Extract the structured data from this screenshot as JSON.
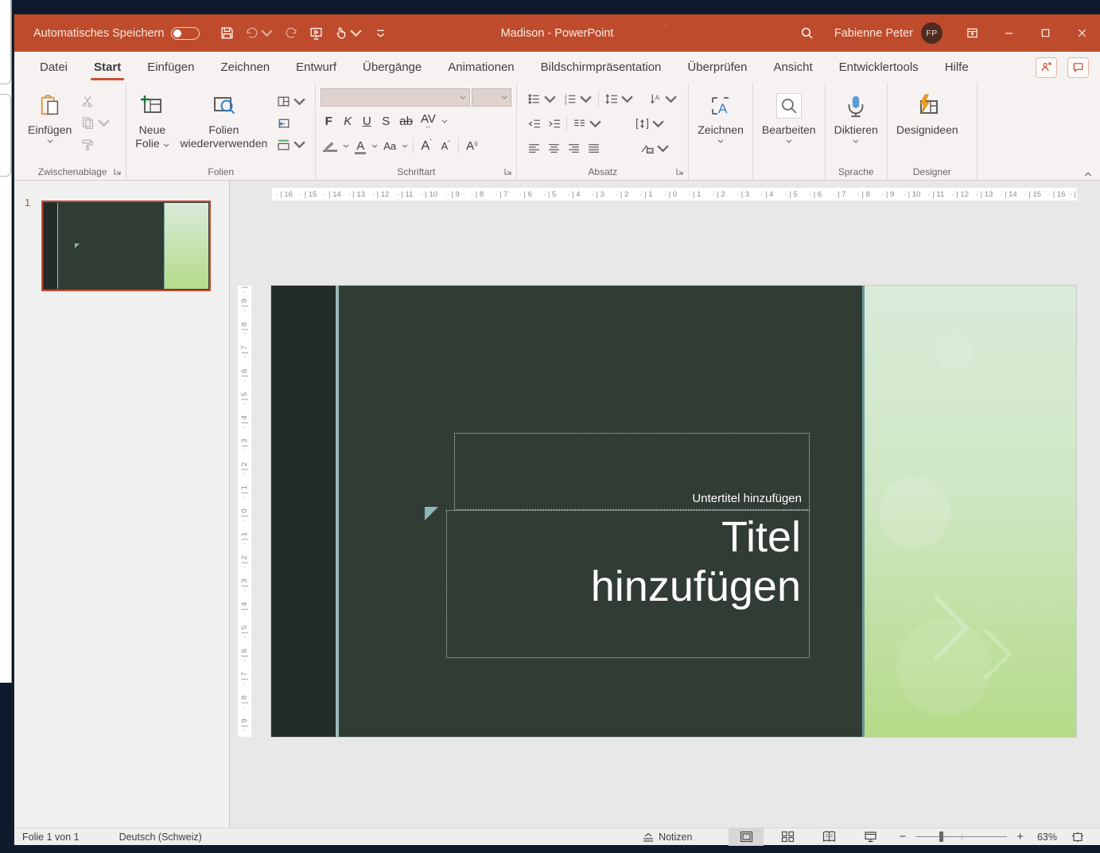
{
  "titlebar": {
    "autosave_label": "Automatisches Speichern",
    "autosave_state": "off",
    "title": "Madison - PowerPoint",
    "user_name": "Fabienne Peter",
    "user_initials": "FP"
  },
  "tabs": [
    {
      "label": "Datei",
      "active": false
    },
    {
      "label": "Start",
      "active": true
    },
    {
      "label": "Einfügen",
      "active": false
    },
    {
      "label": "Zeichnen",
      "active": false
    },
    {
      "label": "Entwurf",
      "active": false
    },
    {
      "label": "Übergänge",
      "active": false
    },
    {
      "label": "Animationen",
      "active": false
    },
    {
      "label": "Bildschirmpräsentation",
      "active": false
    },
    {
      "label": "Überprüfen",
      "active": false
    },
    {
      "label": "Ansicht",
      "active": false
    },
    {
      "label": "Entwicklertools",
      "active": false
    },
    {
      "label": "Hilfe",
      "active": false
    }
  ],
  "ribbon": {
    "clipboard": {
      "paste_label": "Einfügen",
      "group_label": "Zwischenablage"
    },
    "slides": {
      "new_slide_line1": "Neue",
      "new_slide_line2": "Folie",
      "reuse_line1": "Folien",
      "reuse_line2": "wiederverwenden",
      "group_label": "Folien"
    },
    "font": {
      "group_label": "Schriftart",
      "bold": "F",
      "italic": "K",
      "underline": "U",
      "shadow": "S",
      "strikethrough": "ab",
      "spacing": "AV",
      "case_btn": "Aa",
      "grow": "A",
      "shrink": "A",
      "clear": "A"
    },
    "paragraph": {
      "group_label": "Absatz"
    },
    "drawing": {
      "label": "Zeichnen"
    },
    "editing": {
      "label": "Bearbeiten"
    },
    "speech": {
      "dictate_label": "Diktieren",
      "group_label": "Sprache"
    },
    "designer": {
      "ideas_label": "Designideen",
      "group_label": "Designer"
    }
  },
  "thumbnail_panel": {
    "slides": [
      {
        "number": "1"
      }
    ]
  },
  "ruler": {
    "horizontal": [
      "16",
      "15",
      "14",
      "13",
      "12",
      "11",
      "10",
      "9",
      "8",
      "7",
      "6",
      "5",
      "4",
      "3",
      "2",
      "1",
      "0",
      "1",
      "2",
      "3",
      "4",
      "5",
      "6",
      "7",
      "8",
      "9",
      "10",
      "11",
      "12",
      "13",
      "14",
      "15",
      "16"
    ],
    "vertical": [
      "9",
      "8",
      "7",
      "6",
      "5",
      "4",
      "3",
      "2",
      "1",
      "0",
      "1",
      "2",
      "3",
      "4",
      "5",
      "6",
      "7",
      "8",
      "9"
    ]
  },
  "slide": {
    "subtitle_placeholder": "Untertitel hinzufügen",
    "title_placeholder": "Titel hinzufügen"
  },
  "statusbar": {
    "slide_indicator": "Folie 1 von 1",
    "language": "Deutsch (Schweiz)",
    "notes_label": "Notizen",
    "zoom_level": "63%"
  },
  "colors": {
    "titlebar": "#be4b2b",
    "accent_underline": "#c8502e",
    "slide_bg": "#313c35",
    "slide_left_strip": "#232c2a",
    "slide_accent_line": "#9ebbba",
    "green_band_top": "#d9ebda",
    "green_band_bottom": "#b5db89",
    "selection_border": "#c64a2c",
    "taskbar": "#0e1a2b"
  }
}
